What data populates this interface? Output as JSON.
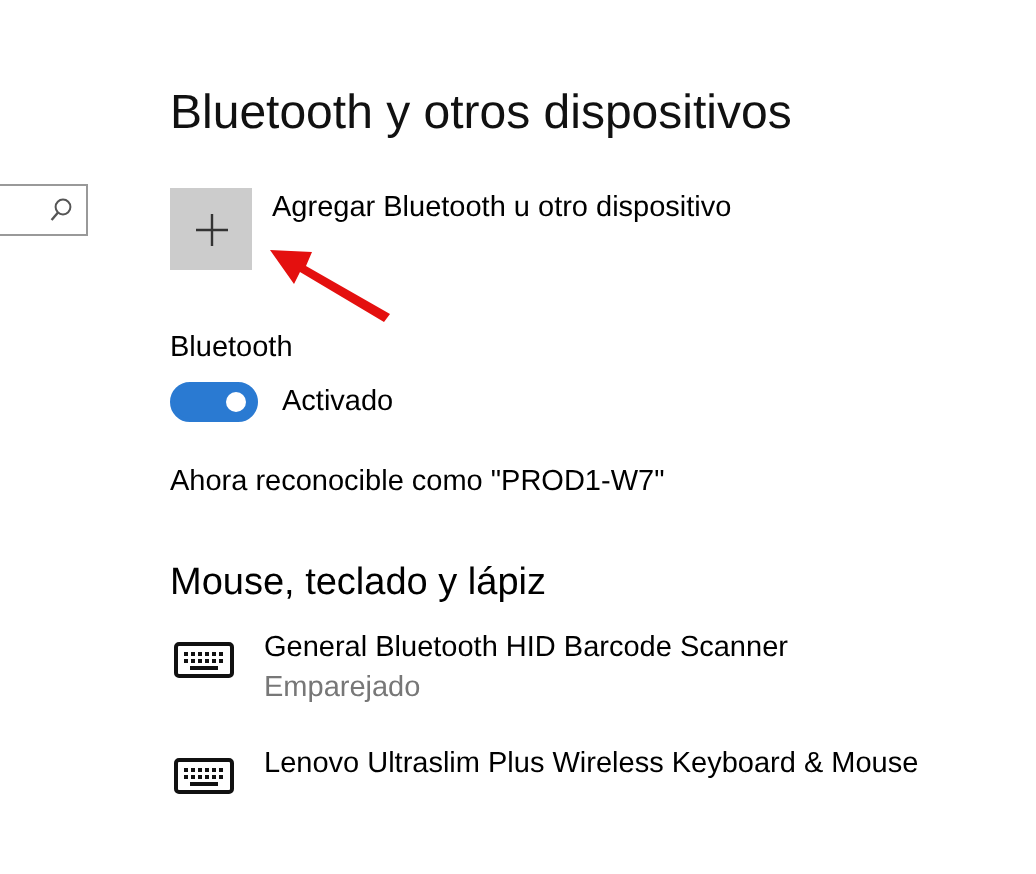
{
  "title": "Bluetooth y otros dispositivos",
  "add_button": {
    "label": "Agregar Bluetooth u otro dispositivo"
  },
  "bluetooth": {
    "label": "Bluetooth",
    "on": true,
    "state_label": "Activado"
  },
  "discoverable": "Ahora reconocible como \"PROD1-W7\"",
  "section": "Mouse, teclado y lápiz",
  "devices": [
    {
      "name": "General Bluetooth HID Barcode Scanner",
      "status": "Emparejado"
    },
    {
      "name": "Lenovo Ultraslim Plus Wireless Keyboard & Mouse"
    }
  ]
}
